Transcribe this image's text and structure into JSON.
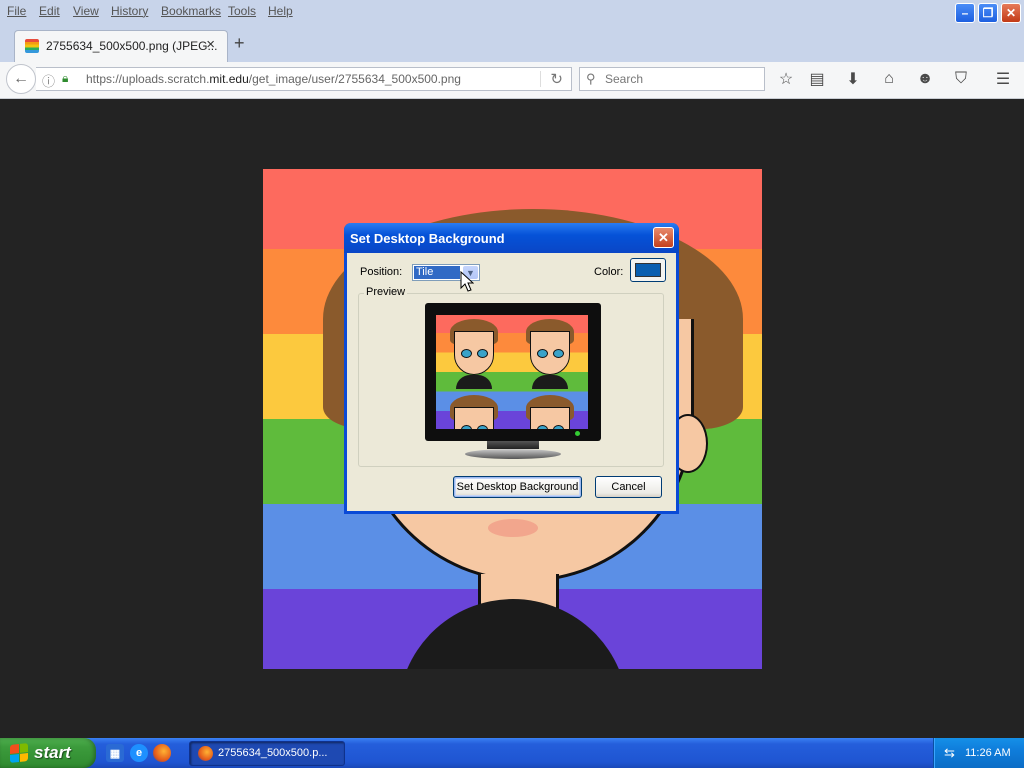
{
  "menubar": {
    "items": [
      "File",
      "Edit",
      "View",
      "History",
      "Bookmarks",
      "Tools",
      "Help"
    ]
  },
  "tab": {
    "title": "2755634_500x500.png (JPEG...",
    "close": "×",
    "new_tab": "+"
  },
  "navbar": {
    "url_prefix": "https://uploads.scratch.",
    "url_domain": "mit.edu",
    "url_path": "/get_image/user/2755634_500x500.png",
    "search_placeholder": "Search"
  },
  "dialog": {
    "title": "Set Desktop Background",
    "position_label": "Position:",
    "position_value": "Tile",
    "color_label": "Color:",
    "color_value": "#0a5fb0",
    "preview_label": "Preview",
    "ok_label": "Set Desktop Background",
    "cancel_label": "Cancel"
  },
  "taskbar": {
    "start_label": "start",
    "task_item": "2755634_500x500.p...",
    "clock": "11:26 AM"
  },
  "colors": {
    "xp_blue": "#0a4ad6",
    "xp_green": "#3c9b3c",
    "rainbow": [
      "#fd6a5e",
      "#fd8a3c",
      "#fcc93e",
      "#5fbb3c",
      "#5b8fe6",
      "#6a44d9"
    ]
  }
}
